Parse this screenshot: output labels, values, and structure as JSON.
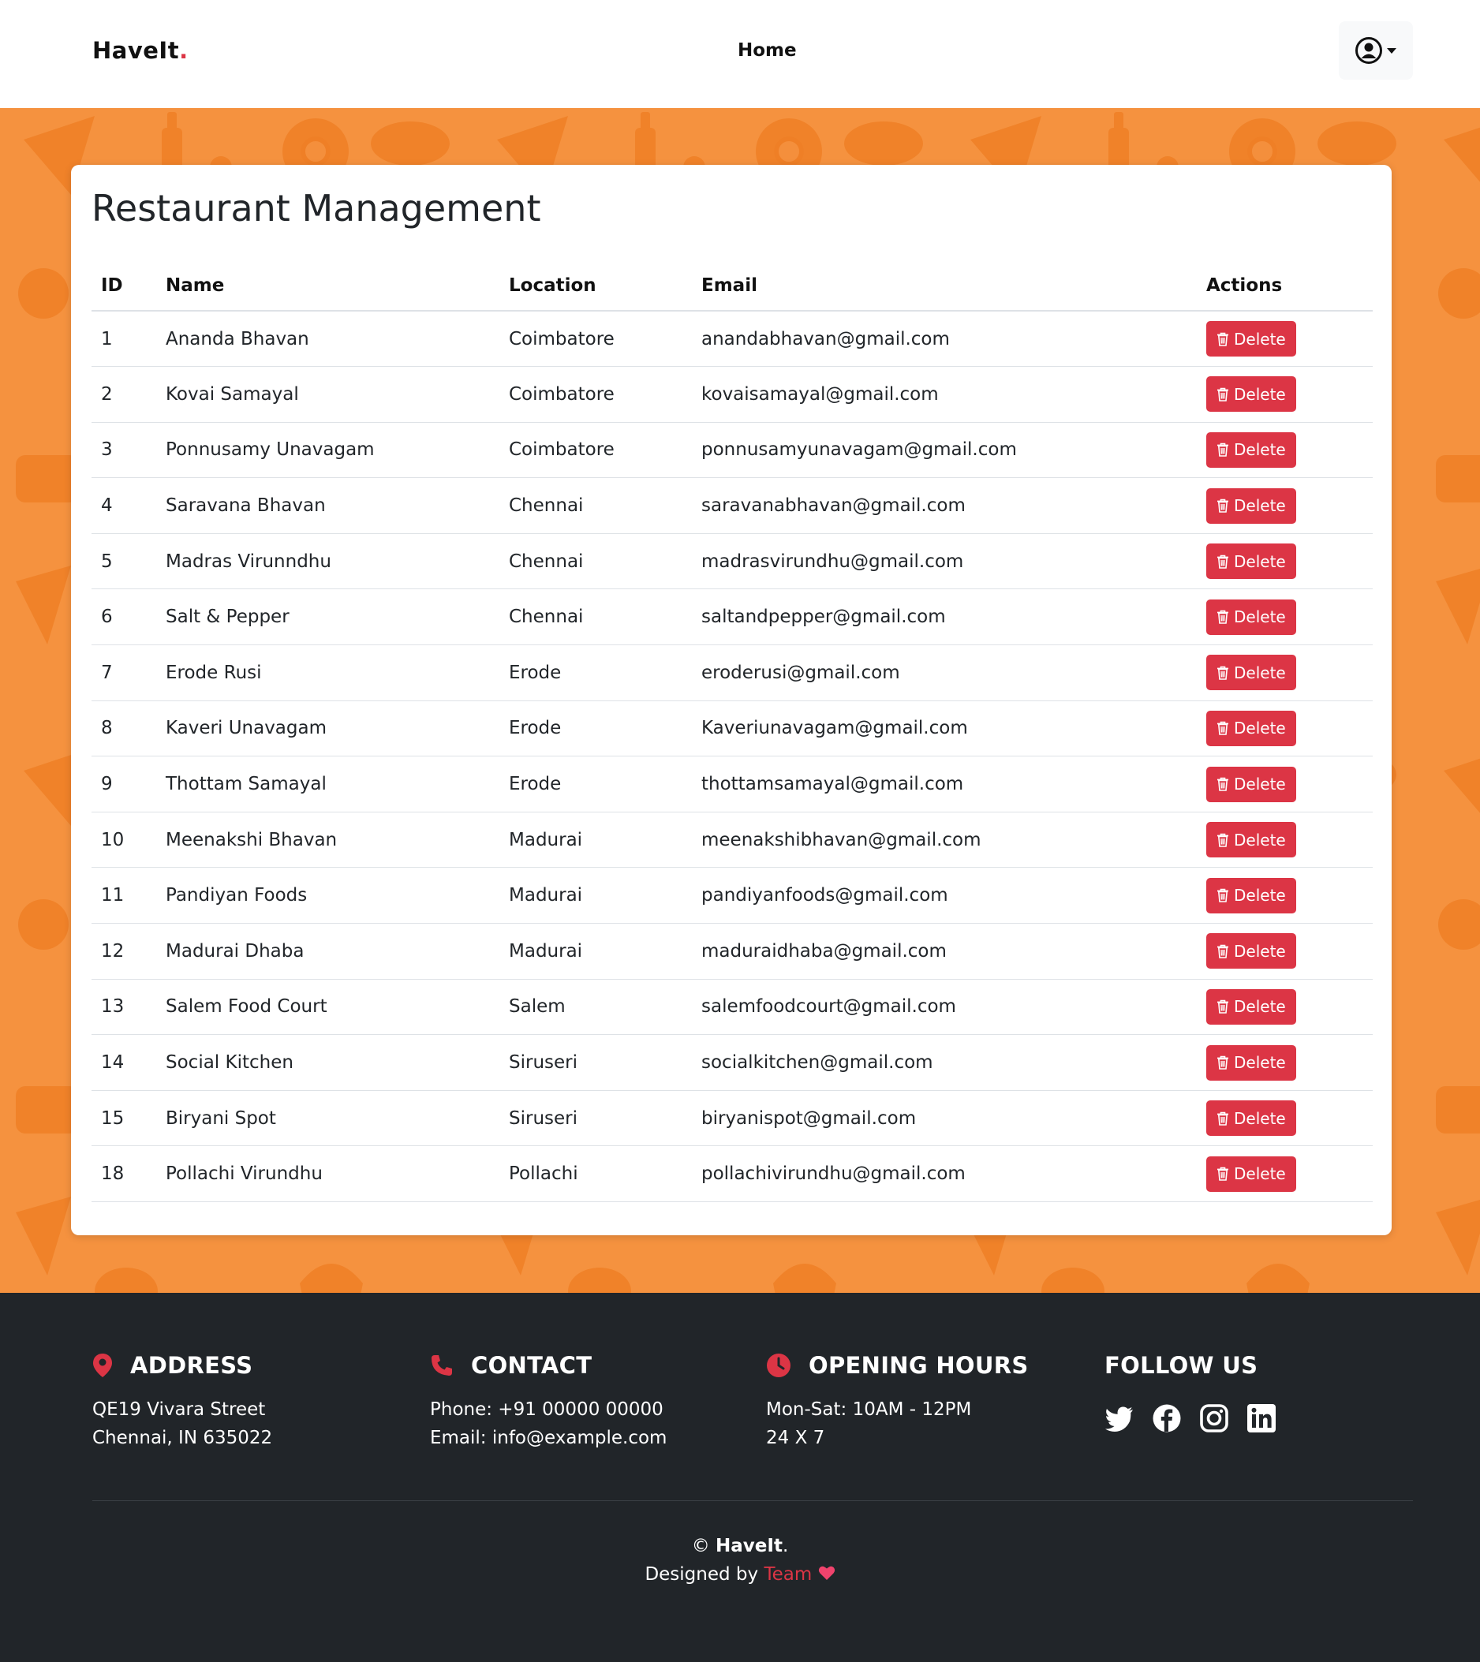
{
  "navbar": {
    "brand": "HaveIt",
    "brand_dot": ".",
    "home_label": "Home"
  },
  "page": {
    "title": "Restaurant Management"
  },
  "table": {
    "headers": [
      "ID",
      "Name",
      "Location",
      "Email",
      "Actions"
    ],
    "action_label": "Delete",
    "rows": [
      {
        "id": "1",
        "name": "Ananda Bhavan",
        "location": "Coimbatore",
        "email": "anandabhavan@gmail.com"
      },
      {
        "id": "2",
        "name": "Kovai Samayal",
        "location": "Coimbatore",
        "email": "kovaisamayal@gmail.com"
      },
      {
        "id": "3",
        "name": "Ponnusamy Unavagam",
        "location": "Coimbatore",
        "email": "ponnusamyunavagam@gmail.com"
      },
      {
        "id": "4",
        "name": "Saravana Bhavan",
        "location": "Chennai",
        "email": "saravanabhavan@gmail.com"
      },
      {
        "id": "5",
        "name": "Madras Virunndhu",
        "location": "Chennai",
        "email": "madrasvirundhu@gmail.com"
      },
      {
        "id": "6",
        "name": "Salt & Pepper",
        "location": "Chennai",
        "email": "saltandpepper@gmail.com"
      },
      {
        "id": "7",
        "name": "Erode Rusi",
        "location": "Erode",
        "email": "eroderusi@gmail.com"
      },
      {
        "id": "8",
        "name": "Kaveri Unavagam",
        "location": "Erode",
        "email": "Kaveriunavagam@gmail.com"
      },
      {
        "id": "9",
        "name": "Thottam Samayal",
        "location": "Erode",
        "email": "thottamsamayal@gmail.com"
      },
      {
        "id": "10",
        "name": "Meenakshi Bhavan",
        "location": "Madurai",
        "email": "meenakshibhavan@gmail.com"
      },
      {
        "id": "11",
        "name": "Pandiyan Foods",
        "location": "Madurai",
        "email": "pandiyanfoods@gmail.com"
      },
      {
        "id": "12",
        "name": "Madurai Dhaba",
        "location": "Madurai",
        "email": "maduraidhaba@gmail.com"
      },
      {
        "id": "13",
        "name": "Salem Food Court",
        "location": "Salem",
        "email": "salemfoodcourt@gmail.com"
      },
      {
        "id": "14",
        "name": "Social Kitchen",
        "location": "Siruseri",
        "email": "socialkitchen@gmail.com"
      },
      {
        "id": "15",
        "name": "Biryani Spot",
        "location": "Siruseri",
        "email": "biryanispot@gmail.com"
      },
      {
        "id": "18",
        "name": "Pollachi Virundhu",
        "location": "Pollachi",
        "email": "pollachivirundhu@gmail.com"
      }
    ]
  },
  "footer": {
    "address": {
      "heading": "ADDRESS",
      "line1": "QE19 Vivara Street",
      "line2": "Chennai, IN 635022",
      "icon": "map-pin-icon"
    },
    "contact": {
      "heading": "CONTACT",
      "line1": "Phone: +91 00000 00000",
      "line2": "Email: info@example.com",
      "icon": "phone-icon"
    },
    "hours": {
      "heading": "OPENING HOURS",
      "line1": "Mon-Sat: 10AM - 12PM",
      "line2": "24 X 7",
      "icon": "clock-icon"
    },
    "follow": {
      "heading": "FOLLOW US",
      "icons": [
        "twitter-icon",
        "facebook-icon",
        "instagram-icon",
        "linkedin-icon"
      ]
    },
    "copyright_symbol": "©",
    "copyright_brand": "HaveIt",
    "copyright_dot": ".",
    "designed_by": "Designed by",
    "team": "Team"
  },
  "colors": {
    "accent": "#dc3545",
    "background_orange": "#f5923f",
    "footer_bg": "#212529"
  }
}
